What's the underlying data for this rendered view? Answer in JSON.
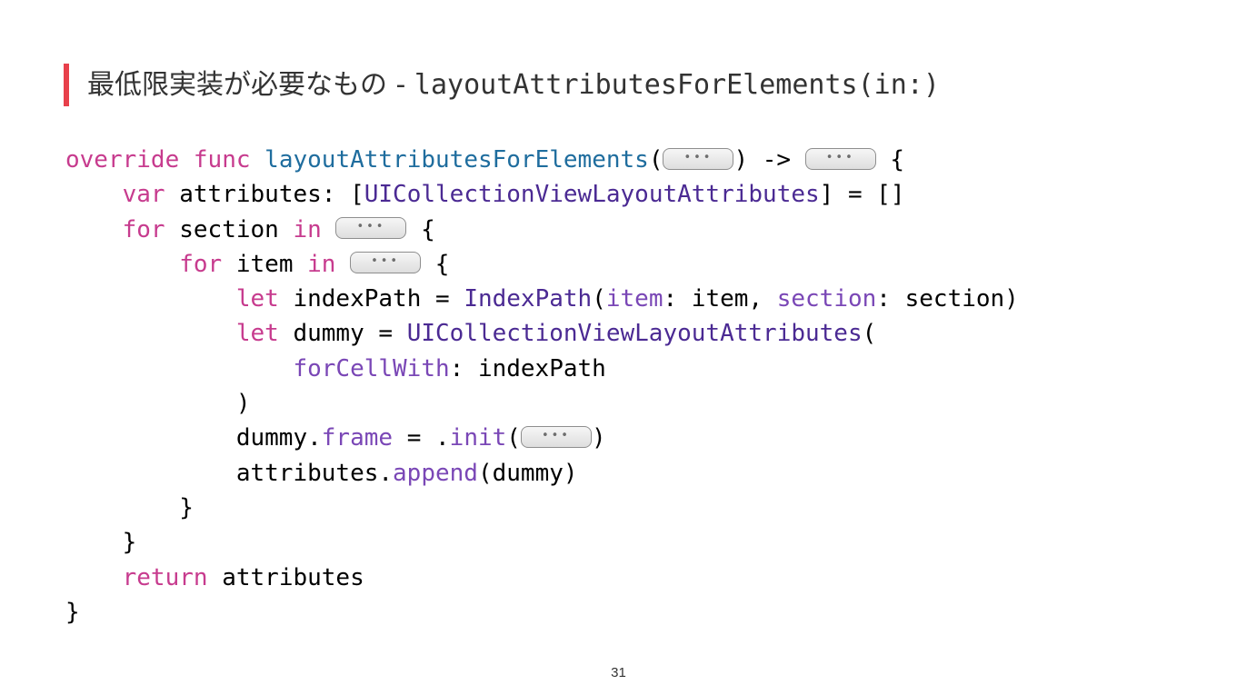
{
  "title": {
    "japanese": "最低限実装が必要なもの",
    "separator": " - ",
    "method": "layoutAttributesForElements(in:)"
  },
  "code": {
    "override_kw": "override",
    "func_kw": "func",
    "func_name": "layoutAttributesForElements",
    "arrow": ") ->",
    "var_kw": "var",
    "attributes_decl": "attributes: [",
    "attr_type": "UICollectionViewLayoutAttributes",
    "attr_init": "] = []",
    "for_kw": "for",
    "section_var": "section",
    "in_kw": "in",
    "item_var": "item",
    "let_kw": "let",
    "index_path_decl": "indexPath = ",
    "index_path_type": "IndexPath",
    "item_label": "item",
    "item_arg": ": item, ",
    "section_label": "section",
    "section_arg": ": section)",
    "dummy_decl": "dummy = ",
    "for_cell_with": "forCellWith",
    "for_cell_with_arg": ": indexPath",
    "dummy_prefix": "dummy.",
    "frame_prop": "frame",
    "equals_dot": " = .",
    "init_fn": "init",
    "attributes_prefix": "attributes.",
    "append_fn": "append",
    "append_arg": "(dummy)",
    "return_kw": "return",
    "return_value": "attributes",
    "placeholder_dots": "•••"
  },
  "page_number": "31",
  "colors": {
    "accent": "#e8404b",
    "keyword": "#c73b8e",
    "function_name": "#1f6d9e",
    "type": "#4b2a93",
    "property": "#7a47b6"
  }
}
